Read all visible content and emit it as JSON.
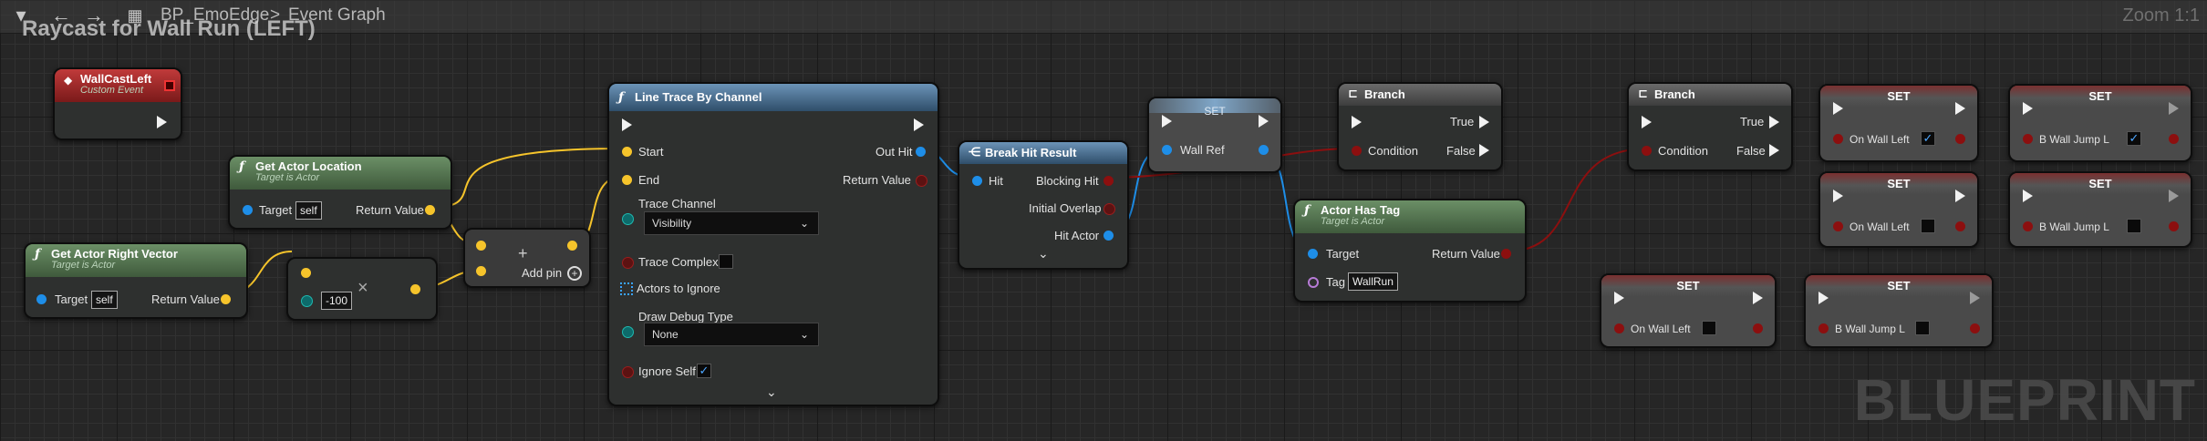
{
  "toolbar": {
    "breadcrumb_root": "BP_EmoEdge",
    "breadcrumb_sep": ">",
    "breadcrumb_leaf": "Event Graph",
    "zoom": "Zoom 1:1",
    "back_icon": "arrow-left",
    "forward_icon": "arrow-right"
  },
  "graph_title": "Raycast for Wall Run (LEFT)",
  "watermark": "BLUEPRINT",
  "nodes": {
    "event": {
      "title": "WallCastLeft",
      "subtitle": "Custom Event"
    },
    "location": {
      "title": "Get Actor Location",
      "subtitle": "Target is Actor",
      "target": "Target",
      "target_value": "self",
      "return": "Return Value"
    },
    "right": {
      "title": "Get Actor Right Vector",
      "subtitle": "Target is Actor",
      "target": "Target",
      "target_value": "self",
      "return": "Return Value"
    },
    "multiply": {
      "value": "-100",
      "op": "×"
    },
    "add": {
      "op": "+",
      "add_pin": "Add pin"
    },
    "trace": {
      "title": "Line Trace By Channel",
      "start": "Start",
      "end": "End",
      "out_hit": "Out Hit",
      "return": "Return Value",
      "channel_label": "Trace Channel",
      "channel_value": "Visibility",
      "complex": "Trace Complex",
      "ignore": "Actors to Ignore",
      "debug_label": "Draw Debug Type",
      "debug_value": "None",
      "ignore_self": "Ignore Self"
    },
    "break": {
      "title": "Break Hit Result",
      "hit": "Hit",
      "blocking": "Blocking Hit",
      "overlap": "Initial Overlap",
      "actor": "Hit Actor"
    },
    "set_wallref": {
      "title": "SET",
      "var": "Wall Ref"
    },
    "branch1": {
      "title": "Branch",
      "true": "True",
      "false": "False",
      "condition": "Condition"
    },
    "hastag": {
      "title": "Actor Has Tag",
      "subtitle": "Target is Actor",
      "target": "Target",
      "tag": "Tag",
      "tag_value": "WallRun",
      "return": "Return Value"
    },
    "branch2": {
      "title": "Branch",
      "true": "True",
      "false": "False",
      "condition": "Condition"
    },
    "set1": {
      "title": "SET",
      "var": "On Wall Left",
      "checked": true
    },
    "set2": {
      "title": "SET",
      "var": "B Wall Jump L",
      "checked": true
    },
    "set3": {
      "title": "SET",
      "var": "On Wall Left",
      "checked": false
    },
    "set4": {
      "title": "SET",
      "var": "B Wall Jump L",
      "checked": false
    },
    "set5": {
      "title": "SET",
      "var": "On Wall Left",
      "checked": false
    },
    "set6": {
      "title": "SET",
      "var": "B Wall Jump L",
      "checked": false
    }
  },
  "colors": {
    "exec": "#f2f2f2",
    "vector": "#f6c42b",
    "object": "#1e8ee8",
    "bool": "#8c0f0f",
    "struct": "#1e8ee8"
  }
}
